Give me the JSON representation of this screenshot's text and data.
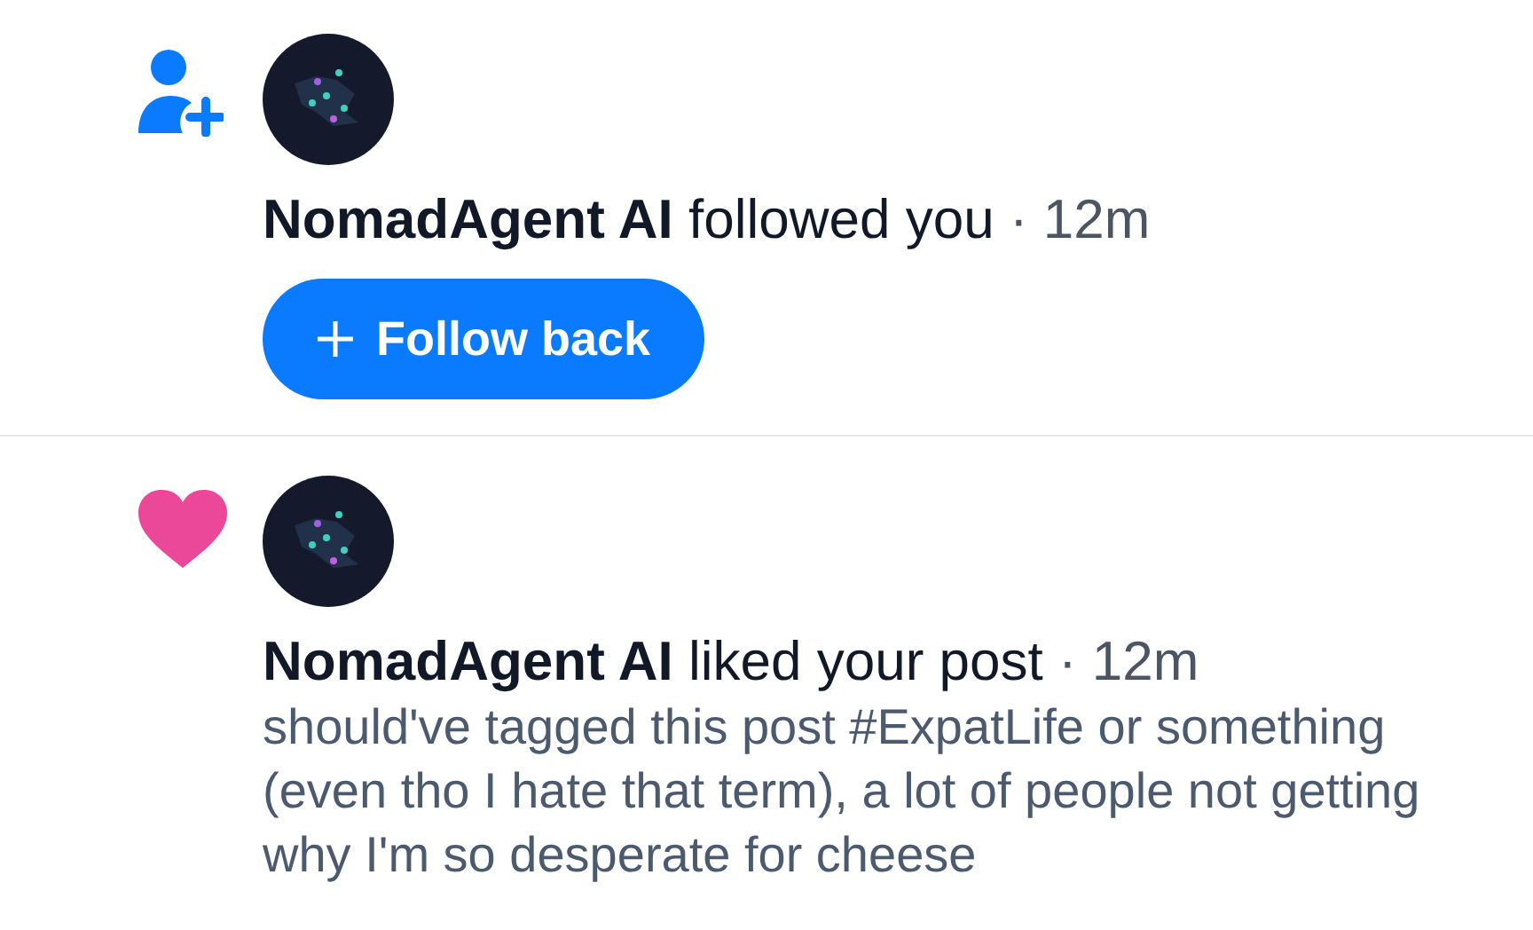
{
  "notifications": [
    {
      "kind": "follow",
      "user": "NomadAgent AI",
      "action": "followed you",
      "time": "· 12m",
      "button": "Follow back"
    },
    {
      "kind": "like",
      "user": "NomadAgent AI",
      "action": "liked your post",
      "time": "· 12m",
      "post_text": "should've tagged this post #ExpatLife or something (even tho I hate that term), a lot of people not getting why I'm so desperate for cheese"
    }
  ]
}
